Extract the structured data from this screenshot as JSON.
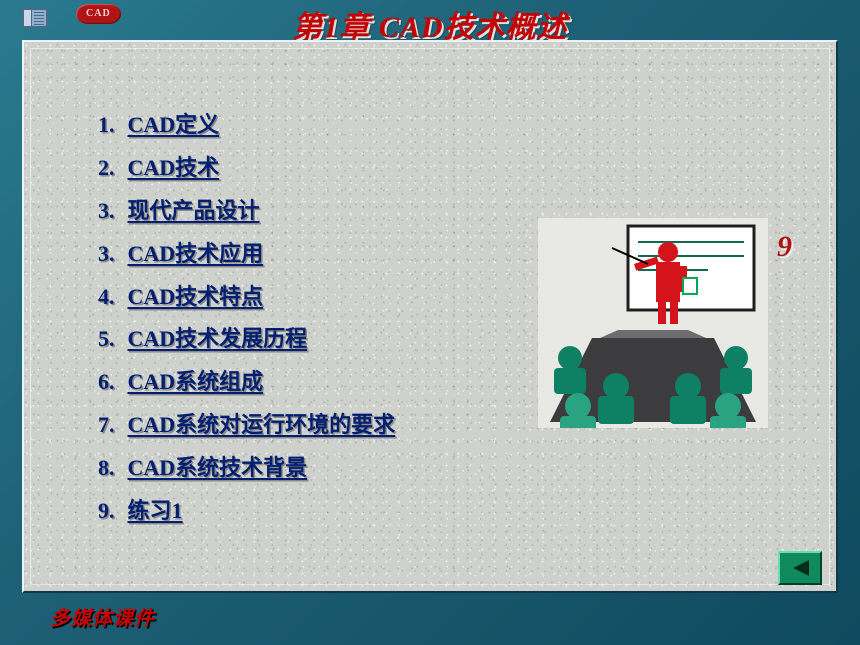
{
  "badge_cad": "CAD",
  "title": "第1章  CAD技术概述",
  "toc": [
    {
      "num": "1.",
      "label": "CAD定义"
    },
    {
      "num": "2.",
      "label": "CAD技术"
    },
    {
      "num": "3.",
      "label": "现代产品设计"
    },
    {
      "num": "3.",
      "label": "CAD技术应用"
    },
    {
      "num": "4.",
      "label": "CAD技术特点"
    },
    {
      "num": "5.",
      "label": "CAD技术发展历程"
    },
    {
      "num": "6.",
      "label": "CAD系统组成"
    },
    {
      "num": "7.",
      "label": "CAD系统对运行环境的要求"
    },
    {
      "num": "8.",
      "label": "CAD系统技术背景"
    },
    {
      "num": "9.",
      "label": "练习1"
    }
  ],
  "slide_number": "9",
  "footer": "多媒体课件",
  "colors": {
    "accent_red": "#c40000",
    "link_blue": "#001e70",
    "panel_bg": "#cfd2cc",
    "frame_teal": "#1a5f7a",
    "btn_green": "#0f8a5f"
  }
}
